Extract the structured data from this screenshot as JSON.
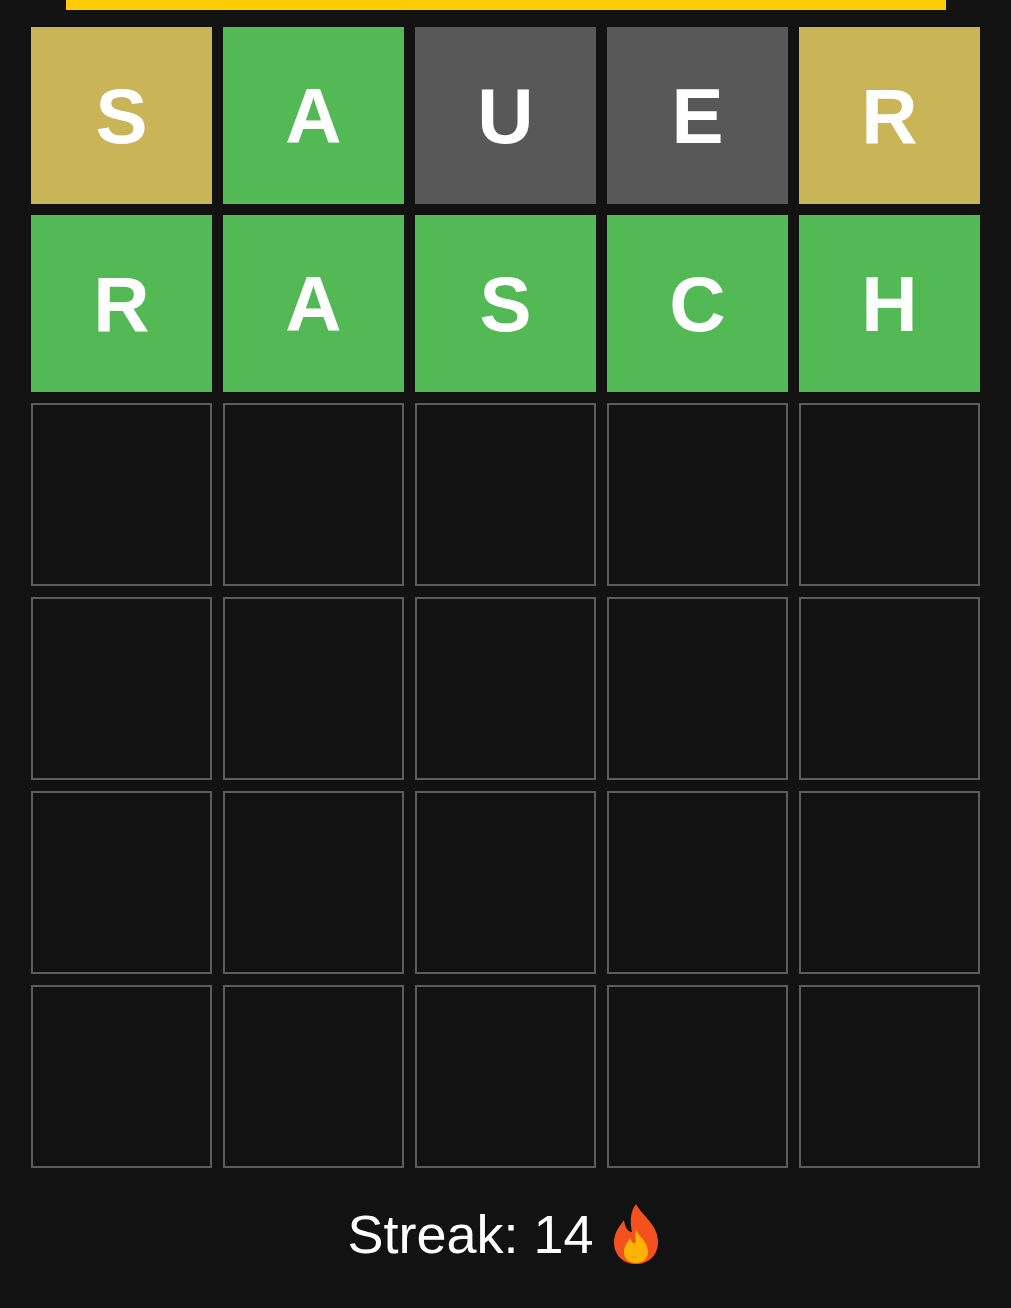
{
  "board": {
    "rows": [
      {
        "tiles": [
          {
            "letter": "S",
            "kind": "present"
          },
          {
            "letter": "A",
            "kind": "correct"
          },
          {
            "letter": "U",
            "kind": "absent"
          },
          {
            "letter": "E",
            "kind": "absent"
          },
          {
            "letter": "R",
            "kind": "present"
          }
        ]
      },
      {
        "tiles": [
          {
            "letter": "R",
            "kind": "correct"
          },
          {
            "letter": "A",
            "kind": "correct"
          },
          {
            "letter": "S",
            "kind": "correct"
          },
          {
            "letter": "C",
            "kind": "correct"
          },
          {
            "letter": "H",
            "kind": "correct"
          }
        ]
      },
      {
        "tiles": [
          {
            "kind": "empty"
          },
          {
            "kind": "empty"
          },
          {
            "kind": "empty"
          },
          {
            "kind": "empty"
          },
          {
            "kind": "empty"
          }
        ]
      },
      {
        "tiles": [
          {
            "kind": "empty"
          },
          {
            "kind": "empty"
          },
          {
            "kind": "empty"
          },
          {
            "kind": "empty"
          },
          {
            "kind": "empty"
          }
        ]
      },
      {
        "tiles": [
          {
            "kind": "empty"
          },
          {
            "kind": "empty"
          },
          {
            "kind": "empty"
          },
          {
            "kind": "empty"
          },
          {
            "kind": "empty"
          }
        ]
      },
      {
        "tiles": [
          {
            "kind": "empty"
          },
          {
            "kind": "empty"
          },
          {
            "kind": "empty"
          },
          {
            "kind": "empty"
          },
          {
            "kind": "empty"
          }
        ]
      }
    ]
  },
  "streak": {
    "label": "Streak: 14"
  }
}
